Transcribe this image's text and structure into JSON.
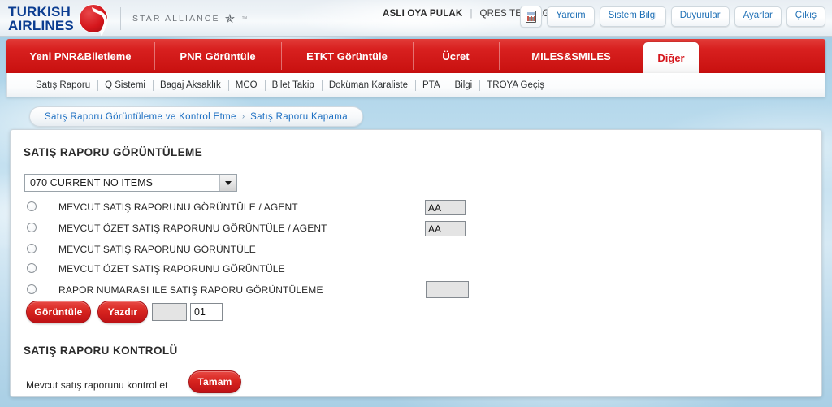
{
  "header": {
    "brand_line1": "TURKISH",
    "brand_line2": "AIRLINES",
    "alliance": "STAR ALLIANCE",
    "alliance_tm": "™",
    "user_name": "ASLI OYA PULAK",
    "user_separator": "|",
    "user_agency": "QRES TEST AGT",
    "icon_button": "calculator-icon",
    "buttons": [
      {
        "label": "Yardım"
      },
      {
        "label": "Sistem Bilgi"
      },
      {
        "label": "Duyurular"
      },
      {
        "label": "Ayarlar"
      },
      {
        "label": "Çıkış"
      }
    ]
  },
  "mainnav": {
    "tabs": [
      {
        "label": "Yeni PNR&Biletleme",
        "active": false
      },
      {
        "label": "PNR Görüntüle",
        "active": false
      },
      {
        "label": "ETKT Görüntüle",
        "active": false
      },
      {
        "label": "Ücret",
        "active": false
      },
      {
        "label": "MILES&SMILES",
        "active": false
      },
      {
        "label": "Diğer",
        "active": true
      }
    ]
  },
  "subnav": {
    "items": [
      {
        "label": "Satış Raporu"
      },
      {
        "label": "Q Sistemi"
      },
      {
        "label": "Bagaj Aksaklık"
      },
      {
        "label": "MCO"
      },
      {
        "label": "Bilet Takip"
      },
      {
        "label": "Doküman Karaliste"
      },
      {
        "label": "PTA"
      },
      {
        "label": "Bilgi"
      },
      {
        "label": "TROYA Geçiş"
      }
    ]
  },
  "breadcrumb": {
    "parent": "Satış Raporu Görüntüleme ve Kontrol Etme",
    "separator": "›",
    "current": "Satış Raporu Kapama"
  },
  "view_section": {
    "title": "SATIŞ RAPORU GÖRÜNTÜLEME",
    "report_select": {
      "value": "070 CURRENT NO ITEMS",
      "arrow_icon": "chevron-down-icon"
    },
    "options": [
      {
        "label": "MEVCUT SATIŞ RAPORUNU GÖRÜNTÜLE / AGENT",
        "selected": false,
        "input_value": "AA",
        "has_input": true
      },
      {
        "label": "MEVCUT ÖZET SATIŞ RAPORUNU GÖRÜNTÜLE / AGENT",
        "selected": false,
        "input_value": "AA",
        "has_input": true
      },
      {
        "label": "MEVCUT SATIŞ RAPORUNU GÖRÜNTÜLE",
        "selected": false,
        "input_value": "",
        "has_input": false
      },
      {
        "label": "MEVCUT ÖZET SATIŞ RAPORUNU GÖRÜNTÜLE",
        "selected": false,
        "input_value": "",
        "has_input": false
      },
      {
        "label": "RAPOR NUMARASI ILE SATIŞ RAPORU GÖRÜNTÜLEME",
        "selected": false,
        "input_value": "",
        "has_input": true
      }
    ],
    "view_button": "Görüntüle",
    "print_button": "Yazdır",
    "blank_field_value": "",
    "sequence_field_value": "01"
  },
  "control_section": {
    "title": "SATIŞ RAPORU KONTROLÜ",
    "description": "Mevcut satış raporunu kontrol et",
    "confirm_button": "Tamam"
  },
  "colors": {
    "brand_red": "#d5161c",
    "brand_blue": "#0b3d91",
    "link_blue": "#1b6ec2",
    "sky": "#aed4e9"
  }
}
